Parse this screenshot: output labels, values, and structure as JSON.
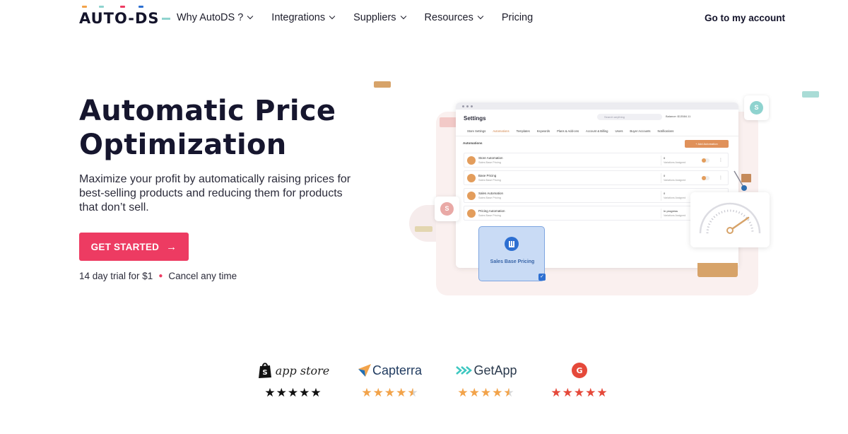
{
  "nav": {
    "logo": "AUTO-DS",
    "links": [
      {
        "label": "Why AutoDS ?",
        "dropdown": true
      },
      {
        "label": "Integrations",
        "dropdown": true
      },
      {
        "label": "Suppliers",
        "dropdown": true
      },
      {
        "label": "Resources",
        "dropdown": true
      },
      {
        "label": "Pricing",
        "dropdown": false
      }
    ],
    "account": "Go to my account"
  },
  "hero": {
    "title": "Automatic Price Optimization",
    "subtitle": "Maximize your profit by automatically raising prices for best-selling products and reducing them for products that don’t sell.",
    "cta": "GET STARTED",
    "cta_icon": "arrow-right-icon",
    "trial_left": "14 day trial for $1",
    "trial_right": "Cancel any time"
  },
  "illustration": {
    "window_title": "Settings",
    "search_placeholder": "Search anything",
    "balance": "Balance: $13584.11",
    "tabs": [
      "Store Settings",
      "Automations",
      "Templates",
      "Keywords",
      "Plans & Add-ons",
      "Account & Billing",
      "Users",
      "Buyer Accounts",
      "Notifications"
    ],
    "active_tab": "Automations",
    "section_label": "Automations",
    "add_button": "+ Add Automation",
    "rows": [
      {
        "name": "Store Automation",
        "sub": "Sales Base Pricing",
        "count": "0",
        "status": "Variations Assigned"
      },
      {
        "name": "Base Pricing",
        "sub": "Sales Base Pricing",
        "count": "0",
        "status": "Variations Assigned"
      },
      {
        "name": "Sales Automation",
        "sub": "Sales Base Pricing",
        "count": "0",
        "status": "Variations Assigned"
      },
      {
        "name": "Pricing Automation",
        "sub": "Sales Base Pricing",
        "count": "In progress",
        "status": "Variations Assigned"
      }
    ],
    "card_label": "Sales Base Pricing",
    "badge_text": "S",
    "colors": {
      "accent": "#ed3b62",
      "orange": "#e0915a",
      "blue": "#2d6fd1",
      "teal": "#8fd3cf"
    }
  },
  "ratings": [
    {
      "brand": "app store",
      "icon": "shopify-bag-icon",
      "rating": 5,
      "star_color": "#111111"
    },
    {
      "brand": "Capterra",
      "icon": "capterra-arrow-icon",
      "rating": 4.5,
      "star_color": "#f2a34a"
    },
    {
      "brand": "GetApp",
      "icon": "getapp-chevrons-icon",
      "rating": 4.5,
      "star_color": "#f2a34a"
    },
    {
      "brand": "",
      "icon": "g2-logo-icon",
      "rating": 5,
      "star_color": "#e5493a"
    }
  ]
}
